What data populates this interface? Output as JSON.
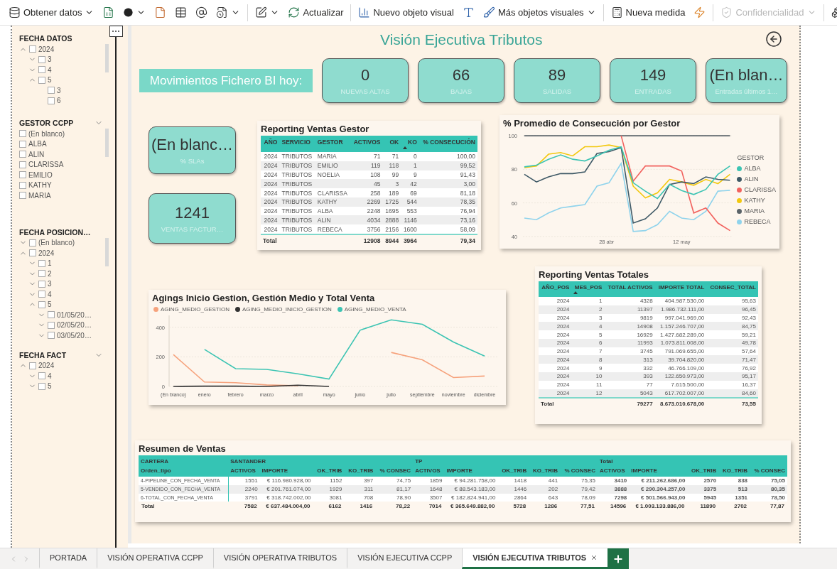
{
  "toolbar": [
    [
      {
        "label": "Obtener datos",
        "caret": true,
        "disabled": false
      },
      {
        "caret": false,
        "disabled": false
      },
      {
        "caret": true,
        "disabled": false
      },
      {
        "caret": false,
        "disabled": false
      },
      {
        "caret": false,
        "disabled": false
      },
      {
        "caret": false,
        "disabled": false
      },
      {
        "caret": true,
        "disabled": false
      }
    ],
    [
      {
        "caret": true,
        "disabled": false
      },
      {
        "label": "Actualizar",
        "caret": false,
        "disabled": false
      }
    ],
    [
      {
        "label": "Nuevo objeto visual",
        "caret": false,
        "disabled": false
      },
      {
        "caret": false,
        "disabled": false
      },
      {
        "label": "Más objetos visuales",
        "caret": true,
        "disabled": false
      }
    ],
    [
      {
        "label": "Nueva medida",
        "caret": false,
        "disabled": false
      },
      {
        "caret": false,
        "disabled": false
      }
    ],
    [
      {
        "label": "Confidencialidad",
        "caret": true,
        "disabled": true
      }
    ],
    [
      {
        "caret": false,
        "disabled": false
      }
    ]
  ],
  "slicers": [
    {
      "title": "FECHA DATOS",
      "collapsible": false,
      "items": [
        {
          "label": "2024",
          "checked": false,
          "expanded": true,
          "children": [
            {
              "label": "3",
              "checked": false,
              "expanded": false
            },
            {
              "label": "4",
              "checked": false,
              "expanded": false
            },
            {
              "label": "5",
              "checked": false,
              "expanded": true,
              "children": [
                {
                  "label": "3",
                  "checked": false
                },
                {
                  "label": "6",
                  "checked": false
                }
              ]
            }
          ]
        }
      ]
    },
    {
      "title": "GESTOR CCPP",
      "collapsible": true,
      "items": [
        {
          "label": "(En blanco)",
          "checked": false
        },
        {
          "label": "ALBA",
          "checked": false
        },
        {
          "label": "ALIN",
          "checked": false
        },
        {
          "label": "CLARISSA",
          "checked": false
        },
        {
          "label": "EMILIO",
          "checked": false
        },
        {
          "label": "KATHY",
          "checked": false
        },
        {
          "label": "MARIA",
          "checked": false
        }
      ]
    },
    {
      "title": "FECHA POSICION…",
      "collapsible": false,
      "items": [
        {
          "label": "(En blanco)",
          "checked": false,
          "expanded": false
        },
        {
          "label": "2024",
          "checked": false,
          "expanded": true,
          "children": [
            {
              "label": "1",
              "checked": false,
              "expanded": false
            },
            {
              "label": "2",
              "checked": false,
              "expanded": false
            },
            {
              "label": "3",
              "checked": false,
              "expanded": false
            },
            {
              "label": "4",
              "checked": false,
              "expanded": false
            },
            {
              "label": "5",
              "checked": false,
              "expanded": true,
              "children": [
                {
                  "label": "01/05/20…",
                  "checked": false,
                  "expanded": false
                },
                {
                  "label": "02/05/20…",
                  "checked": false,
                  "expanded": false
                },
                {
                  "label": "03/05/20…",
                  "checked": false,
                  "expanded": false
                }
              ]
            }
          ]
        }
      ]
    },
    {
      "title": "FECHA FACT",
      "collapsible": true,
      "items": [
        {
          "label": "2024",
          "checked": false,
          "expanded": true,
          "children": [
            {
              "label": "4",
              "checked": false,
              "expanded": false
            },
            {
              "label": "5",
              "checked": false,
              "expanded": false
            }
          ]
        }
      ]
    }
  ],
  "report": {
    "title": "Visión Ejecutiva Tributos",
    "banner": "Movimientos Fichero BI hoy:",
    "kpi_cards": [
      {
        "value": "0",
        "label": "NUEVAS ALTAS"
      },
      {
        "value": "66",
        "label": "BAJAS"
      },
      {
        "value": "89",
        "label": "SALIDAS"
      },
      {
        "value": "149",
        "label": "ENTRADAS"
      },
      {
        "value": "(En blan…",
        "label": "Entradas últimos 1…"
      }
    ],
    "side_cards": [
      {
        "value": "(En blanc…",
        "label": "% SLAs"
      },
      {
        "value": "1241",
        "label": "VENTAS FACTUR…"
      }
    ],
    "gestor_table": {
      "title": "Reporting Ventas Gestor",
      "columns": [
        {
          "label": "AÑO",
          "sorted": false
        },
        {
          "label": "SERVICIO",
          "sorted": false
        },
        {
          "label": "GESTOR",
          "sorted": false
        },
        {
          "label": "ACTIVOS",
          "sorted": false
        },
        {
          "label": "OK",
          "sorted": false
        },
        {
          "label": "KO",
          "sorted": true
        },
        {
          "label": "% CONSECUCIÓN",
          "sorted": false
        }
      ],
      "rows": [
        {
          "year": "2024",
          "service": "TRIBUTOS",
          "gestor": "MARIA",
          "activos": "71",
          "ok": "71",
          "ko": "0",
          "consecucion": "100,00"
        },
        {
          "year": "2024",
          "service": "TRIBUTOS",
          "gestor": "EMILIO",
          "activos": "119",
          "ok": "118",
          "ko": "1",
          "consecucion": "99,52"
        },
        {
          "year": "2024",
          "service": "TRIBUTOS",
          "gestor": "NOELIA",
          "activos": "108",
          "ok": "99",
          "ko": "9",
          "consecucion": "91,43"
        },
        {
          "year": "2024",
          "service": "TRIBUTOS",
          "activos": "45",
          "ok": "3",
          "ko": "42",
          "consecucion": "3,00"
        },
        {
          "year": "2024",
          "service": "TRIBUTOS",
          "gestor": "CLARISSA",
          "activos": "258",
          "ok": "189",
          "ko": "69",
          "consecucion": "81,18"
        },
        {
          "year": "2024",
          "service": "TRIBUTOS",
          "gestor": "KATHY",
          "activos": "2269",
          "ok": "1725",
          "ko": "544",
          "consecucion": "78,35"
        },
        {
          "year": "2024",
          "service": "TRIBUTOS",
          "gestor": "ALBA",
          "activos": "2248",
          "ok": "1695",
          "ko": "553",
          "consecucion": "76,94"
        },
        {
          "year": "2024",
          "service": "TRIBUTOS",
          "gestor": "ALIN",
          "activos": "4034",
          "ok": "2888",
          "ko": "1146",
          "consecucion": "73,16"
        },
        {
          "year": "2024",
          "service": "TRIBUTOS",
          "gestor": "REBECA",
          "activos": "3756",
          "ok": "2156",
          "ko": "1600",
          "consecucion": "58,09"
        }
      ],
      "total": {
        "label": "Total",
        "activos": "12908",
        "ok": "8944",
        "ko": "3964",
        "consecucion": "79,34"
      }
    },
    "consecucion_chart": {
      "legend_title": "GESTOR",
      "date_labels": [
        "28 abr",
        "12 may"
      ],
      "chart_data": {
        "type": "line",
        "title": "% Promedio de Consecución por Gestor",
        "yticks": [
          40,
          60,
          80,
          100
        ],
        "ylim": [
          40,
          100
        ],
        "series": [
          {
            "name": "ALBA",
            "color": "#3cc4b3",
            "values": [
              81.5,
              82.5,
              86,
              88.6,
              86,
              85,
              88,
              91.4,
              93.4,
              72,
              67,
              62.6,
              71,
              67.4,
              65,
              68,
              77,
              82
            ]
          },
          {
            "name": "ALIN",
            "color": "#3e5966",
            "values": [
              77,
              72.5,
              75.5,
              77.5,
              77.5,
              78.5,
              89.5,
              90.5,
              93,
              48,
              50.5,
              57,
              71,
              72.5,
              71.5,
              75.5,
              74,
              73.5
            ]
          },
          {
            "name": "CLARISSA",
            "color": "#f2625e",
            "values": [
              null,
              null,
              null,
              null,
              null,
              null,
              null,
              null,
              100,
              73,
              82,
              82,
              82,
              79,
              54,
              57,
              48,
              43.5
            ]
          },
          {
            "name": "KATHY",
            "color": "#f2c80f",
            "values": [
              81,
              82,
              89,
              90,
              88,
              93.5,
              93.5,
              94.5,
              93,
              70,
              63,
              66,
              74,
              72.5,
              70.5,
              74,
              71.5,
              77
            ]
          },
          {
            "name": "MARIA",
            "color": "#5a6368",
            "values": [
              100,
              100,
              100,
              100,
              100,
              100,
              100,
              100,
              100,
              100,
              100,
              100,
              100,
              100,
              100,
              100,
              100,
              100
            ]
          },
          {
            "name": "REBECA",
            "color": "#8fd3ec",
            "values": [
              51,
              50,
              54,
              57,
              58,
              59,
              70,
              72,
              83.5,
              43,
              43.5,
              47,
              55,
              51,
              50,
              55,
              67,
              67.5
            ]
          }
        ]
      }
    },
    "aging_chart": {
      "chart_data": {
        "type": "line",
        "title": "Agings Inicio Gestion, Gestión Medio y Total Venta",
        "categories": [
          "(En blanco)",
          "enero",
          "febrero",
          "marzo",
          "abril",
          "mayo",
          "junio",
          "julio",
          "septiembre",
          "noviembre",
          "diciembre"
        ],
        "yticks": [
          0,
          200,
          400
        ],
        "ylim": [
          0,
          480
        ],
        "series": [
          {
            "name": "AGING_MEDIO_GESTION",
            "color": "#f6a27c",
            "values": [
              215,
              30,
              25,
              10,
              5,
              null,
              null,
              230,
              180,
              60,
              70
            ]
          },
          {
            "name": "AGING_MEDIO_INICIO_GESTION",
            "color": "#333333",
            "values": [
              0,
              2,
              2,
              0,
              8,
              0,
              null,
              null,
              null,
              null,
              null
            ]
          },
          {
            "name": "AGING_MEDIO_VENTA",
            "color": "#3cc4b3",
            "values": [
              null,
              250,
              120,
              115,
              85,
              50,
              380,
              450,
              420,
              300,
              205
            ]
          }
        ]
      }
    },
    "totales_table": {
      "title": "Reporting Ventas Totales",
      "columns": [
        {
          "label": "AÑO_POS",
          "sorted": false
        },
        {
          "label": "MES_POS",
          "sorted": true
        },
        {
          "label": "TOTAL ACTIVOS",
          "sorted": false
        },
        {
          "label": "IMPORTE TOTAL",
          "sorted": false
        },
        {
          "label": "CONSEC_TOTAL",
          "sorted": false
        }
      ],
      "rows": [
        {
          "year": "2024",
          "month": "1",
          "activos": "4328",
          "importe": "404.987.530,00",
          "consec": "95,63"
        },
        {
          "year": "2024",
          "month": "2",
          "activos": "11397",
          "importe": "1.986.732.111,00",
          "consec": "96,45"
        },
        {
          "year": "2024",
          "month": "3",
          "activos": "9819",
          "importe": "997.041.969,00",
          "consec": "92,43"
        },
        {
          "year": "2024",
          "month": "4",
          "activos": "14908",
          "importe": "1.157.246.707,00",
          "consec": "84,75"
        },
        {
          "year": "2024",
          "month": "5",
          "activos": "16929",
          "importe": "1.427.682.289,00",
          "consec": "59,21"
        },
        {
          "year": "2024",
          "month": "6",
          "activos": "11993",
          "importe": "1.073.811.008,00",
          "consec": "49,78"
        },
        {
          "year": "2024",
          "month": "7",
          "activos": "3745",
          "importe": "791.069.655,00",
          "consec": "57,64"
        },
        {
          "year": "2024",
          "month": "8",
          "activos": "313",
          "importe": "39.704.820,00",
          "consec": "71,47"
        },
        {
          "year": "2024",
          "month": "9",
          "activos": "332",
          "importe": "46.766.109,00",
          "consec": "76,92"
        },
        {
          "year": "2024",
          "month": "10",
          "activos": "393",
          "importe": "122.650.973,00",
          "consec": "95,17"
        },
        {
          "year": "2024",
          "month": "11",
          "activos": "77",
          "importe": "7.615.500,00",
          "consec": "16,37"
        },
        {
          "year": "2024",
          "month": "12",
          "activos": "5043",
          "importe": "617.702.007,00",
          "consec": "84,60"
        }
      ],
      "total": {
        "label": "Total",
        "activos": "79277",
        "importe": "8.673.010.678,00",
        "consec": "73,55"
      }
    },
    "resumen_table": {
      "title": "Resumen de Ventas",
      "groups": [
        {
          "label": "CARTERA",
          "columns": [
            "Orden_tipo"
          ]
        },
        {
          "label": "SANTANDER",
          "columns": [
            "ACTIVOS",
            "IMPORTE",
            "OK_TRIB",
            "KO_TRIB",
            "% CONSEC"
          ]
        },
        {
          "label": "TP",
          "columns": [
            "ACTIVOS",
            "IMPORTE",
            "OK_TRIB",
            "KO_TRIB",
            "% CONSEC"
          ]
        },
        {
          "label": "Total",
          "columns": [
            "ACTIVOS",
            "IMPORTE",
            "OK_TRIB",
            "KO_TRIB",
            "% CONSEC"
          ]
        }
      ],
      "rows": [
        [
          "4-PIPELINE_CON_FECHA_VENTA",
          "1551",
          "€ 116.980.928,00",
          "1152",
          "397",
          "74,75",
          "1859",
          "€ 94.281.758,00",
          "1418",
          "441",
          "75,35",
          "3410",
          "€ 211.262.686,00",
          "2570",
          "838",
          "75,05"
        ],
        [
          "5-VENDIDO_CON_FECHA_VENTA",
          "2240",
          "€ 201.761.074,00",
          "1929",
          "311",
          "81,17",
          "1648",
          "€ 88.543.183,00",
          "1446",
          "202",
          "79,42",
          "3888",
          "€ 290.304.257,00",
          "3375",
          "513",
          "80,35"
        ],
        [
          "6-TOTAL_CON_FECHA_VENTA",
          "3791",
          "€ 318.742.002,00",
          "3081",
          "708",
          "78,90",
          "3507",
          "€ 182.824.941,00",
          "2864",
          "643",
          "78,09",
          "7298",
          "€ 501.566.943,00",
          "5945",
          "1351",
          "78,50"
        ]
      ],
      "total": [
        "Total",
        "7582",
        "€ 637.484.004,00",
        "6162",
        "1416",
        "78,22",
        "7014",
        "€ 365.649.882,00",
        "5728",
        "1286",
        "77,51",
        "14596",
        "€ 1.003.133.886,00",
        "11890",
        "2702",
        "77,87"
      ]
    }
  },
  "page_tabs": [
    {
      "label": "PORTADA",
      "selected": false
    },
    {
      "label": "VISIÓN OPERATIVA CCPP",
      "selected": false
    },
    {
      "label": "VISIÓN OPERATIVA TRIBUTOS",
      "selected": false
    },
    {
      "label": "VISIÓN EJECUTIVA CCPP",
      "selected": false
    },
    {
      "label": "VISIÓN EJECUTIVA TRIBUTOS",
      "selected": true
    }
  ]
}
